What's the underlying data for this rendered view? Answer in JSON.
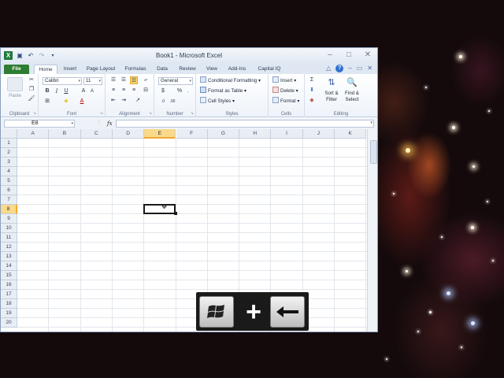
{
  "app": {
    "window_title": "Book1 - Microsoft Excel"
  },
  "tabs": [
    "File",
    "Home",
    "Insert",
    "Page Layout",
    "Formulas",
    "Data",
    "Review",
    "View",
    "Add-Ins",
    "Capital IQ"
  ],
  "active_tab": "Home",
  "ribbon": {
    "clipboard": {
      "label": "Clipboard",
      "paste": "Paste"
    },
    "font": {
      "label": "Font",
      "family": "Calibri",
      "size": "11"
    },
    "alignment": {
      "label": "Alignment"
    },
    "number": {
      "label": "Number",
      "format": "General"
    },
    "styles": {
      "label": "Styles",
      "conditional_formatting": "Conditional Formatting",
      "format_as_table": "Format as Table",
      "cell_styles": "Cell Styles"
    },
    "cells": {
      "label": "Cells",
      "insert": "Insert",
      "delete": "Delete",
      "format": "Format"
    },
    "editing": {
      "label": "Editing",
      "sort_filter": "Sort & Filter",
      "find_select": "Find & Select"
    }
  },
  "formula_bar": {
    "name_box": "E8",
    "fx": "fx",
    "value": ""
  },
  "grid": {
    "columns": [
      "A",
      "B",
      "C",
      "D",
      "E",
      "F",
      "G",
      "H",
      "I",
      "J",
      "K"
    ],
    "rows": [
      "1",
      "2",
      "3",
      "4",
      "5",
      "6",
      "7",
      "8",
      "9",
      "10",
      "11",
      "12",
      "13",
      "14",
      "15",
      "16",
      "17",
      "18",
      "19",
      "20"
    ],
    "active_column": "E",
    "active_row": "8"
  },
  "shortcut_overlay": {
    "keys": [
      "windows-key",
      "plus",
      "left-arrow-key"
    ],
    "plus_symbol": "+"
  }
}
